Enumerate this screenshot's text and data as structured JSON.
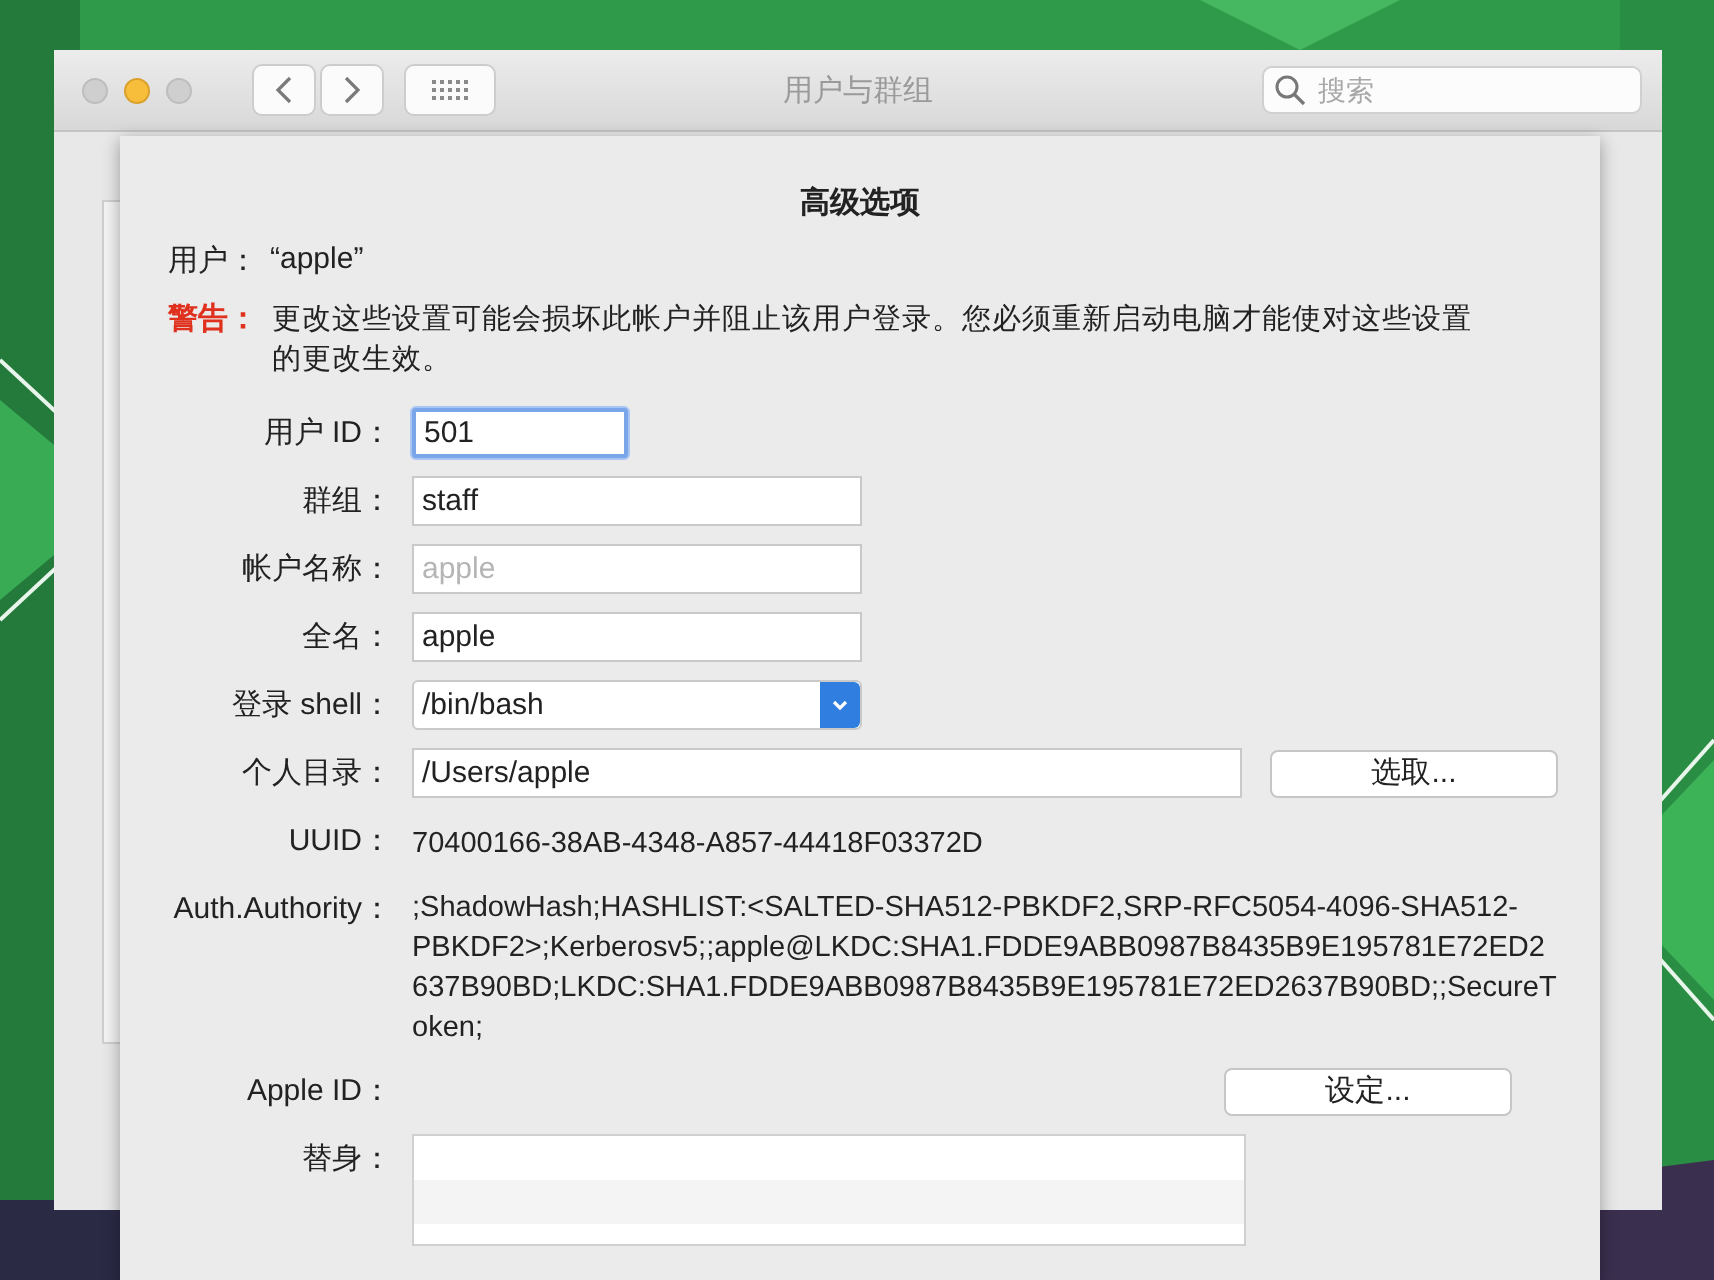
{
  "window": {
    "title": "用户与群组",
    "search": {
      "placeholder": "搜索"
    }
  },
  "sheet": {
    "title": "高级选项",
    "user_label": "用户：",
    "user_value": "“apple”",
    "warning_label": "警告：",
    "warning_text": "更改这些设置可能会损坏此帐户并阻止该用户登录。您必须重新启动电脑才能使对这些设置的更改生效。"
  },
  "rows": [
    {
      "label": "用户 ID：",
      "kind": "field",
      "value": "501",
      "focused": true,
      "disabled": false
    },
    {
      "label": "群组：",
      "kind": "field",
      "value": "staff",
      "focused": false,
      "disabled": false
    },
    {
      "label": "帐户名称：",
      "kind": "field",
      "value": "apple",
      "focused": false,
      "disabled": true
    },
    {
      "label": "全名：",
      "kind": "field",
      "value": "apple",
      "focused": false,
      "disabled": false
    },
    {
      "label": "登录 shell：",
      "kind": "popup",
      "value": "/bin/bash"
    },
    {
      "label": "个人目录：",
      "kind": "field",
      "value": "/Users/apple",
      "focused": false,
      "disabled": false,
      "button": "选取..."
    },
    {
      "label": "UUID：",
      "kind": "text",
      "value": "70400166-38AB-4348-A857-44418F03372D"
    },
    {
      "label": "Auth.Authority：",
      "kind": "text",
      "value": ";ShadowHash;HASHLIST:<SALTED-SHA512-PBKDF2,SRP-RFC5054-4096-SHA512-PBKDF2>;Kerberosv5;;apple@LKDC:SHA1.FDDE9ABB0987B8435B9E195781E72ED2637B90BD;LKDC:SHA1.FDDE9ABB0987B8435B9E195781E72ED2637B90BD;;SecureToken;"
    },
    {
      "label": "Apple ID：",
      "kind": "action",
      "button": "设定..."
    },
    {
      "label": "替身：",
      "kind": "list"
    }
  ]
}
